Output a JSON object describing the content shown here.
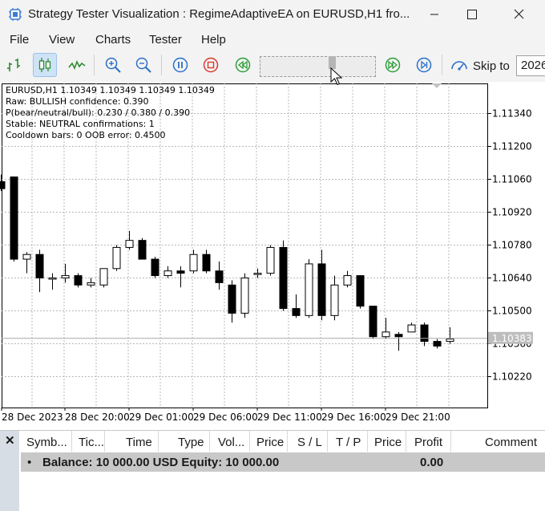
{
  "window": {
    "title": "Strategy Tester Visualization : RegimeAdaptiveEA on EURUSD,H1 fro..."
  },
  "menu": [
    "File",
    "View",
    "Charts",
    "Tester",
    "Help"
  ],
  "toolbar": {
    "buttons": [
      "bar-chart-icon",
      "candlestick-icon",
      "line-chart-icon",
      "zoom-in-icon",
      "zoom-out-icon",
      "pause-icon",
      "stop-icon",
      "rewind-icon",
      "fast-forward-icon",
      "skip-end-icon"
    ],
    "skip_label": "Skip to",
    "skip_value": "2026"
  },
  "chart": {
    "info_lines": [
      "EURUSD,H1  1.10349 1.10349 1.10349 1.10349",
      "Raw: BULLISH  confidence: 0.390",
      "P(bear/neutral/bull): 0.230 / 0.380 / 0.390",
      "Stable: NEUTRAL  confirmations: 1",
      "Cooldown bars: 0  OOB error: 0.4500"
    ],
    "current_price_label": "1.10383"
  },
  "chart_data": {
    "type": "candlestick",
    "symbol": "EURUSD",
    "timeframe": "H1",
    "price_ticks": [
      "1.11340",
      "1.11200",
      "1.11060",
      "1.10920",
      "1.10780",
      "1.10640",
      "1.10500",
      "1.10360",
      "1.10220"
    ],
    "time_labels": [
      "28 Dec 2023",
      "28 Dec 20:00",
      "29 Dec 01:00",
      "29 Dec 06:00",
      "29 Dec 11:00",
      "29 Dec 16:00",
      "29 Dec 21:00"
    ],
    "current_price": 1.10383,
    "candles": [
      {
        "o": 1.1105,
        "h": 1.1108,
        "l": 1.1101,
        "c": 1.1102
      },
      {
        "o": 1.1107,
        "h": 1.1107,
        "l": 1.1071,
        "c": 1.1072
      },
      {
        "o": 1.1072,
        "h": 1.1075,
        "l": 1.1066,
        "c": 1.1074
      },
      {
        "o": 1.1074,
        "h": 1.1076,
        "l": 1.1058,
        "c": 1.1064
      },
      {
        "o": 1.1064,
        "h": 1.1066,
        "l": 1.1059,
        "c": 1.1064
      },
      {
        "o": 1.1064,
        "h": 1.107,
        "l": 1.1062,
        "c": 1.1065
      },
      {
        "o": 1.1065,
        "h": 1.1066,
        "l": 1.106,
        "c": 1.1061
      },
      {
        "o": 1.1061,
        "h": 1.1064,
        "l": 1.106,
        "c": 1.1062
      },
      {
        "o": 1.1061,
        "h": 1.1068,
        "l": 1.106,
        "c": 1.1068
      },
      {
        "o": 1.1068,
        "h": 1.1078,
        "l": 1.1067,
        "c": 1.1077
      },
      {
        "o": 1.1077,
        "h": 1.1084,
        "l": 1.1076,
        "c": 1.108
      },
      {
        "o": 1.108,
        "h": 1.1081,
        "l": 1.1072,
        "c": 1.1072
      },
      {
        "o": 1.1072,
        "h": 1.1073,
        "l": 1.1064,
        "c": 1.1065
      },
      {
        "o": 1.1065,
        "h": 1.1069,
        "l": 1.1064,
        "c": 1.1067
      },
      {
        "o": 1.1067,
        "h": 1.1069,
        "l": 1.106,
        "c": 1.1066
      },
      {
        "o": 1.1067,
        "h": 1.1076,
        "l": 1.1066,
        "c": 1.1074
      },
      {
        "o": 1.1074,
        "h": 1.1076,
        "l": 1.1066,
        "c": 1.1067
      },
      {
        "o": 1.1067,
        "h": 1.1071,
        "l": 1.1059,
        "c": 1.1062
      },
      {
        "o": 1.1061,
        "h": 1.1063,
        "l": 1.1045,
        "c": 1.1049
      },
      {
        "o": 1.1049,
        "h": 1.1066,
        "l": 1.1047,
        "c": 1.1064
      },
      {
        "o": 1.1066,
        "h": 1.1068,
        "l": 1.1064,
        "c": 1.1066
      },
      {
        "o": 1.1066,
        "h": 1.1078,
        "l": 1.1065,
        "c": 1.1077
      },
      {
        "o": 1.1077,
        "h": 1.108,
        "l": 1.105,
        "c": 1.1051
      },
      {
        "o": 1.1051,
        "h": 1.1057,
        "l": 1.1047,
        "c": 1.1048
      },
      {
        "o": 1.1048,
        "h": 1.1072,
        "l": 1.1047,
        "c": 1.107
      },
      {
        "o": 1.107,
        "h": 1.1076,
        "l": 1.1046,
        "c": 1.1048
      },
      {
        "o": 1.1048,
        "h": 1.1065,
        "l": 1.1046,
        "c": 1.1061
      },
      {
        "o": 1.1061,
        "h": 1.1067,
        "l": 1.106,
        "c": 1.1065
      },
      {
        "o": 1.1065,
        "h": 1.1065,
        "l": 1.1051,
        "c": 1.1052
      },
      {
        "o": 1.1052,
        "h": 1.1052,
        "l": 1.1038,
        "c": 1.1039
      },
      {
        "o": 1.1039,
        "h": 1.1047,
        "l": 1.1038,
        "c": 1.1041
      },
      {
        "o": 1.104,
        "h": 1.1041,
        "l": 1.1033,
        "c": 1.1039
      },
      {
        "o": 1.1041,
        "h": 1.1045,
        "l": 1.1041,
        "c": 1.1044
      },
      {
        "o": 1.1044,
        "h": 1.1045,
        "l": 1.1035,
        "c": 1.1037
      },
      {
        "o": 1.1037,
        "h": 1.1038,
        "l": 1.1034,
        "c": 1.1035
      },
      {
        "o": 1.1037,
        "h": 1.1043,
        "l": 1.1036,
        "c": 1.1038
      }
    ]
  },
  "bottom_panel": {
    "columns": [
      "Symb...",
      "Tic...",
      "Time",
      "Type",
      "Vol...",
      "Price",
      "S / L",
      "T / P",
      "Price",
      "Profit",
      "Comment"
    ],
    "summary": {
      "bullet": "•",
      "text": "Balance: 10 000.00 USD  Equity: 10 000.00",
      "profit": "0.00"
    }
  }
}
